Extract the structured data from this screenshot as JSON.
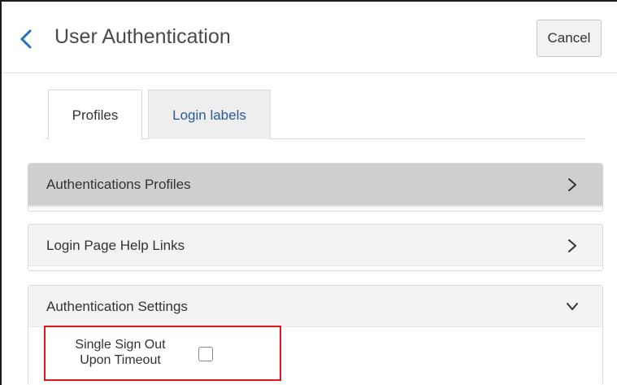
{
  "header": {
    "title": "User Authentication",
    "cancel_label": "Cancel",
    "back_icon": "chevron-left-icon",
    "accent_color": "#1e73be"
  },
  "tabs": [
    {
      "label": "Profiles",
      "active": true
    },
    {
      "label": "Login labels",
      "active": false
    }
  ],
  "sections": [
    {
      "label": "Authentications Profiles",
      "expanded": false,
      "icon": "chevron-right-icon"
    },
    {
      "label": "Login Page Help Links",
      "expanded": false,
      "icon": "chevron-right-icon"
    },
    {
      "label": "Authentication Settings",
      "expanded": true,
      "icon": "chevron-down-icon"
    }
  ],
  "settings": {
    "single_sign_out": {
      "label_line1": "Single Sign Out",
      "label_line2": "Upon Timeout",
      "checked": false,
      "highlight_color": "#e0151b"
    }
  }
}
